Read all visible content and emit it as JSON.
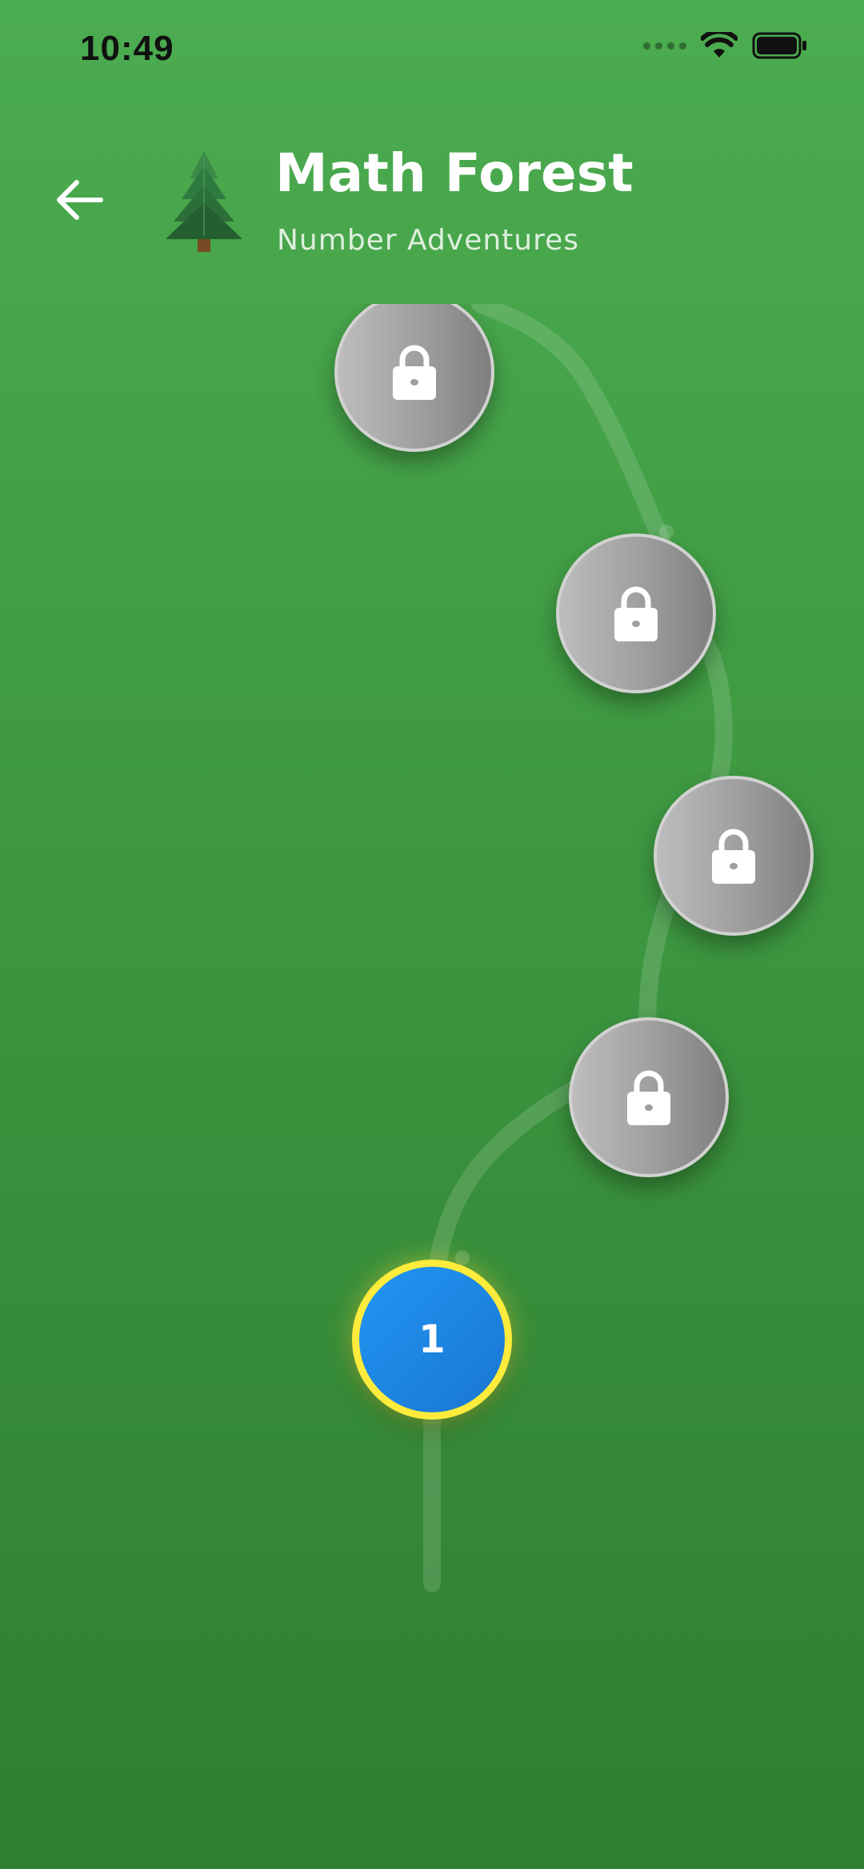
{
  "status_bar": {
    "time": "10:49"
  },
  "header": {
    "title": "Math Forest",
    "subtitle": "Number Adventures",
    "back_icon": "arrow-left-icon",
    "world_icon": "evergreen-tree-icon"
  },
  "levels": [
    {
      "label": "",
      "state": "locked",
      "icon": "lock-icon"
    },
    {
      "label": "",
      "state": "locked",
      "icon": "lock-icon"
    },
    {
      "label": "",
      "state": "locked",
      "icon": "lock-icon"
    },
    {
      "label": "",
      "state": "locked",
      "icon": "lock-icon"
    },
    {
      "label": "1",
      "state": "current",
      "icon": ""
    }
  ],
  "colors": {
    "background_top": "#4cac50",
    "background_bottom": "#2f7f31",
    "current_level": "#2196f3",
    "current_level_ring": "#ffeb3b",
    "locked_level": "#9e9e9e"
  }
}
